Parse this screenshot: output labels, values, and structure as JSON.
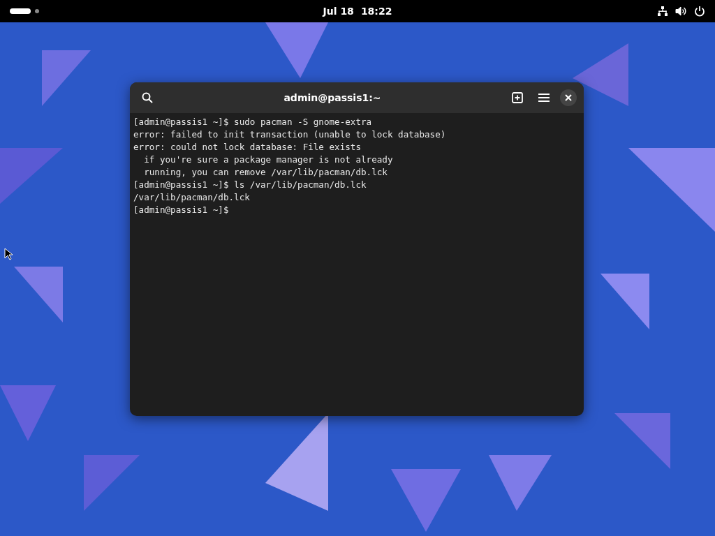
{
  "top_bar": {
    "workspaces": [
      {
        "selected": true
      },
      {
        "selected": false
      }
    ],
    "date": "Jul 18",
    "time": "18:22"
  },
  "terminal": {
    "title": "admin@passis1:~",
    "lines": [
      "[admin@passis1 ~]$ sudo pacman -S gnome-extra",
      "error: failed to init transaction (unable to lock database)",
      "error: could not lock database: File exists",
      "  if you're sure a package manager is not already",
      "  running, you can remove /var/lib/pacman/db.lck",
      "[admin@passis1 ~]$ ls /var/lib/pacman/db.lck",
      "/var/lib/pacman/db.lck",
      "[admin@passis1 ~]$"
    ]
  }
}
